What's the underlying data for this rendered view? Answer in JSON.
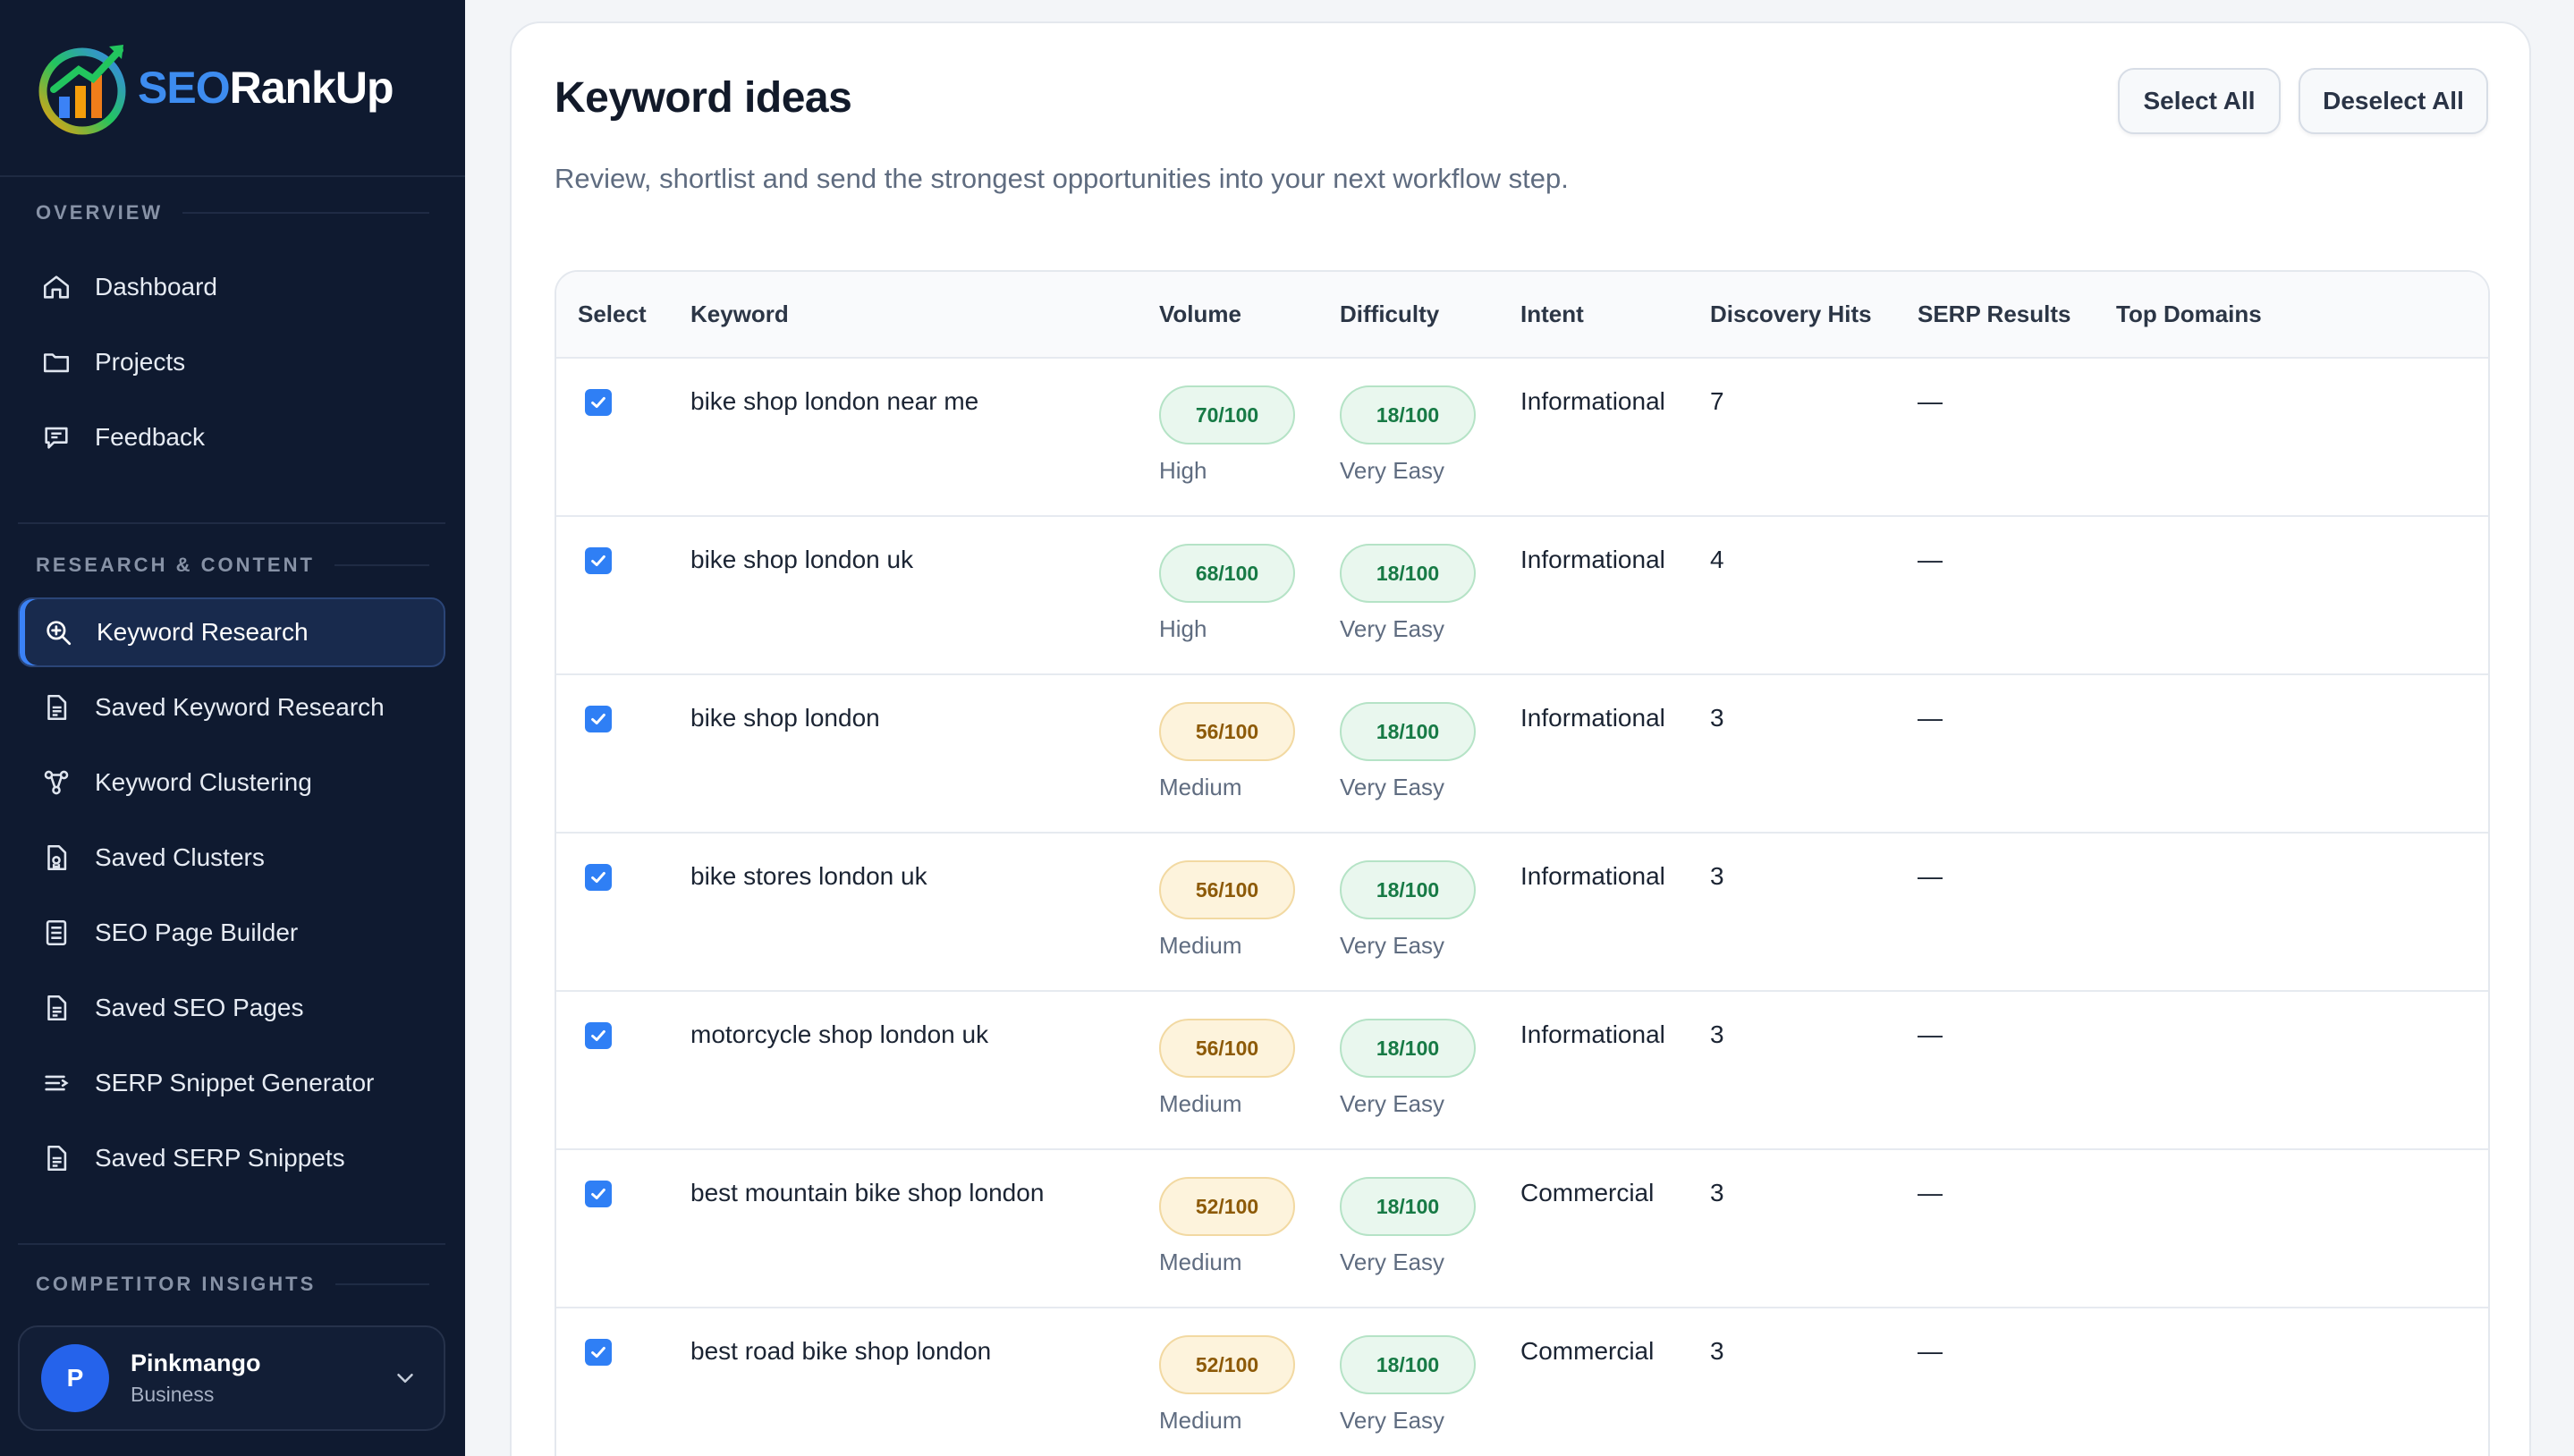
{
  "brand": {
    "seo": "SEO",
    "rest": "RankUp"
  },
  "sidebar": {
    "overview_label": "OVERVIEW",
    "overview_items": [
      {
        "label": "Dashboard",
        "icon": "home-icon"
      },
      {
        "label": "Projects",
        "icon": "folder-icon"
      },
      {
        "label": "Feedback",
        "icon": "chat-icon"
      }
    ],
    "research_label": "RESEARCH & CONTENT",
    "research_items": [
      {
        "label": "Keyword Research",
        "icon": "search-icon",
        "active": true
      },
      {
        "label": "Saved Keyword Research",
        "icon": "document-icon"
      },
      {
        "label": "Keyword Clustering",
        "icon": "cluster-icon"
      },
      {
        "label": "Saved Clusters",
        "icon": "saved-document-icon"
      },
      {
        "label": "SEO Page Builder",
        "icon": "page-icon"
      },
      {
        "label": "Saved SEO Pages",
        "icon": "document-icon"
      },
      {
        "label": "SERP Snippet Generator",
        "icon": "lines-icon"
      },
      {
        "label": "Saved SERP Snippets",
        "icon": "document-icon"
      }
    ],
    "competitor_label": "COMPETITOR INSIGHTS"
  },
  "user": {
    "initial": "P",
    "name": "Pinkmango",
    "plan": "Business"
  },
  "main": {
    "title": "Keyword ideas",
    "subtitle": "Review, shortlist and send the strongest opportunities into your next workflow step.",
    "select_all": "Select All",
    "deselect_all": "Deselect All"
  },
  "table": {
    "headers": [
      "Select",
      "Keyword",
      "Volume",
      "Difficulty",
      "Intent",
      "Discovery Hits",
      "SERP Results",
      "Top Domains"
    ],
    "rows": [
      {
        "checked": true,
        "keyword": "bike shop london near me",
        "volume": "70/100",
        "volume_label": "High",
        "difficulty": "18/100",
        "difficulty_label": "Very Easy",
        "intent": "Informational",
        "hits": "7",
        "serp": "—",
        "domains": ""
      },
      {
        "checked": true,
        "keyword": "bike shop london uk",
        "volume": "68/100",
        "volume_label": "High",
        "difficulty": "18/100",
        "difficulty_label": "Very Easy",
        "intent": "Informational",
        "hits": "4",
        "serp": "—",
        "domains": ""
      },
      {
        "checked": true,
        "keyword": "bike shop london",
        "volume": "56/100",
        "volume_label": "Medium",
        "difficulty": "18/100",
        "difficulty_label": "Very Easy",
        "intent": "Informational",
        "hits": "3",
        "serp": "—",
        "domains": ""
      },
      {
        "checked": true,
        "keyword": "bike stores london uk",
        "volume": "56/100",
        "volume_label": "Medium",
        "difficulty": "18/100",
        "difficulty_label": "Very Easy",
        "intent": "Informational",
        "hits": "3",
        "serp": "—",
        "domains": ""
      },
      {
        "checked": true,
        "keyword": "motorcycle shop london uk",
        "volume": "56/100",
        "volume_label": "Medium",
        "difficulty": "18/100",
        "difficulty_label": "Very Easy",
        "intent": "Informational",
        "hits": "3",
        "serp": "—",
        "domains": ""
      },
      {
        "checked": true,
        "keyword": "best mountain bike shop london",
        "volume": "52/100",
        "volume_label": "Medium",
        "difficulty": "18/100",
        "difficulty_label": "Very Easy",
        "intent": "Commercial",
        "hits": "3",
        "serp": "—",
        "domains": ""
      },
      {
        "checked": true,
        "keyword": "best road bike shop london",
        "volume": "52/100",
        "volume_label": "Medium",
        "difficulty": "18/100",
        "difficulty_label": "Very Easy",
        "intent": "Commercial",
        "hits": "3",
        "serp": "—",
        "domains": ""
      }
    ]
  },
  "colors": {
    "sidebar_bg": "#0f1a30",
    "accent": "#3b82f6",
    "high_pill": "#e9f7ee",
    "medium_pill": "#fdf3dc"
  }
}
